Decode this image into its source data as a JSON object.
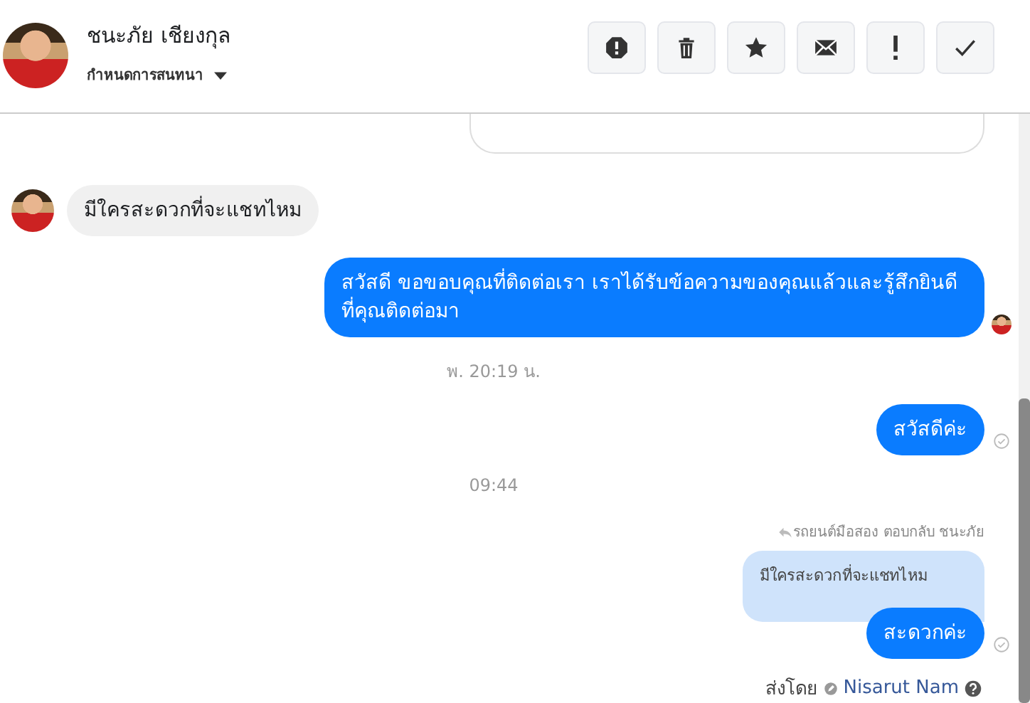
{
  "header": {
    "name": "ชนะภัย เชียงกุล",
    "subtitle": "กำหนดการสนทนา",
    "actions": [
      {
        "kind": "alert"
      },
      {
        "kind": "trash"
      },
      {
        "kind": "star"
      },
      {
        "kind": "mail"
      },
      {
        "kind": "exclaim"
      },
      {
        "kind": "check"
      }
    ]
  },
  "messages": [
    {
      "kind": "cut-outgoing"
    },
    {
      "kind": "incoming",
      "text": "มีใครสะดวกที่จะแชทไหม"
    },
    {
      "kind": "outgoing",
      "text": "สวัสดี ขอขอบคุณที่ติดต่อเรา เราได้รับข้อความของคุณแล้วและรู้สึกยินดีที่คุณติดต่อมา",
      "seen_avatar": true
    },
    {
      "kind": "time",
      "text": "พ. 20:19 น."
    },
    {
      "kind": "outgoing",
      "text": "สวัสดีค่ะ",
      "sent_check": true
    },
    {
      "kind": "time",
      "text": "09:44"
    },
    {
      "kind": "reply",
      "label": "รถยนต์มือสอง ตอบกลับ ชนะภัย",
      "quote": "มีใครสะดวกที่จะแชทไหม",
      "text": "สะดวกค่ะ",
      "sent_check": true
    }
  ],
  "sent_by": {
    "label": "ส่งโดย",
    "name": "Nisarut Nam"
  }
}
